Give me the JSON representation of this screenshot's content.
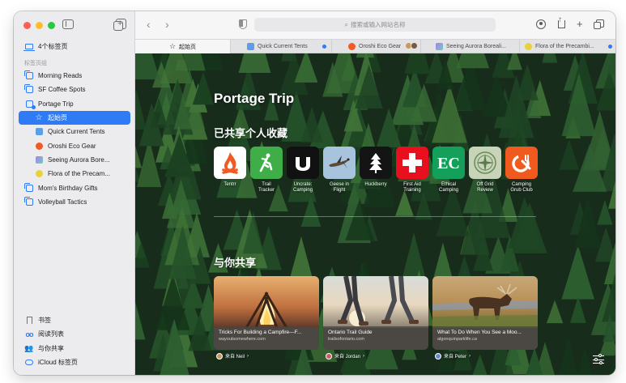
{
  "sidebar": {
    "tabs_count_label": "4个标签页",
    "section_label": "标签页组",
    "groups": [
      {
        "label": "Morning Reads"
      },
      {
        "label": "SF Coffee Spots"
      },
      {
        "label": "Portage Trip"
      }
    ],
    "portage_tabs": [
      {
        "label": "起始页",
        "icon": "star-icon",
        "selected": true
      },
      {
        "label": "Quick Current Tents",
        "icon": "tent-favicon",
        "color": "#5aa0e8"
      },
      {
        "label": "Oroshi Eco Gear",
        "icon": "eco-favicon",
        "color": "#f05a24"
      },
      {
        "label": "Seeing Aurora Bore...",
        "icon": "aurora-favicon",
        "color": "#b07ae8"
      },
      {
        "label": "Flora of the Precam...",
        "icon": "flora-favicon",
        "color": "#e8d040"
      }
    ],
    "more_groups": [
      {
        "label": "Mom's Birthday Gifts"
      },
      {
        "label": "Volleyball Tactics"
      }
    ],
    "bottom": [
      {
        "label": "书签",
        "icon": "bookmark-icon"
      },
      {
        "label": "阅读列表",
        "icon": "reading-list-icon"
      },
      {
        "label": "与你共享",
        "icon": "shared-with-you-icon"
      },
      {
        "label": "iCloud 标签页",
        "icon": "icloud-icon"
      }
    ]
  },
  "toolbar": {
    "back": "‹",
    "forward": "›",
    "url_placeholder": "搜索或输入网站名称",
    "new_tab": "+"
  },
  "tabs": [
    {
      "label": "起始页",
      "active": true
    },
    {
      "label": "Quick Current Tents",
      "color": "#5aa0e8",
      "dot": true
    },
    {
      "label": "Oroshi Eco Gear",
      "color": "#f05a24",
      "avatars": true
    },
    {
      "label": "Seeing Aurora Boreali...",
      "color": "#b07ae8"
    },
    {
      "label": "Flora of the Precambi...",
      "color": "#e8d040",
      "dot": true
    }
  ],
  "content": {
    "title": "Portage Trip",
    "favorites_heading": "已共享个人收藏",
    "shared_heading": "与你共享",
    "favorites": [
      {
        "label": "Tentrr",
        "icon": "tentrr-icon"
      },
      {
        "label": "Trail\nTracker",
        "icon": "trail-tracker-icon"
      },
      {
        "label": "Uncrate:\nCamping",
        "icon": "uncrate-icon"
      },
      {
        "label": "Geese in\nFlight",
        "icon": "geese-icon"
      },
      {
        "label": "Huckberry",
        "icon": "huckberry-icon"
      },
      {
        "label": "First Aid\nTraining",
        "icon": "first-aid-icon"
      },
      {
        "label": "Ethical\nCamping",
        "icon": "ethical-camping-icon"
      },
      {
        "label": "Off Grid\nReview",
        "icon": "off-grid-icon"
      },
      {
        "label": "Camping\nGrub Club",
        "icon": "grub-club-icon"
      }
    ],
    "shared_cards": [
      {
        "title": "Tricks For Building a Campfire—F...",
        "url": "wayoutsomewhere.com",
        "from": "来自 Neil",
        "avatar_color": "#c89a60"
      },
      {
        "title": "Ontario Trail Guide",
        "url": "trailsofontario.com",
        "from": "来自 Jordan",
        "avatar_color": "#d05a6a"
      },
      {
        "title": "What To Do When You See a Moo...",
        "url": "algonquinparklife.ca",
        "from": "来自 Peter",
        "avatar_color": "#6a8ad0"
      }
    ]
  }
}
